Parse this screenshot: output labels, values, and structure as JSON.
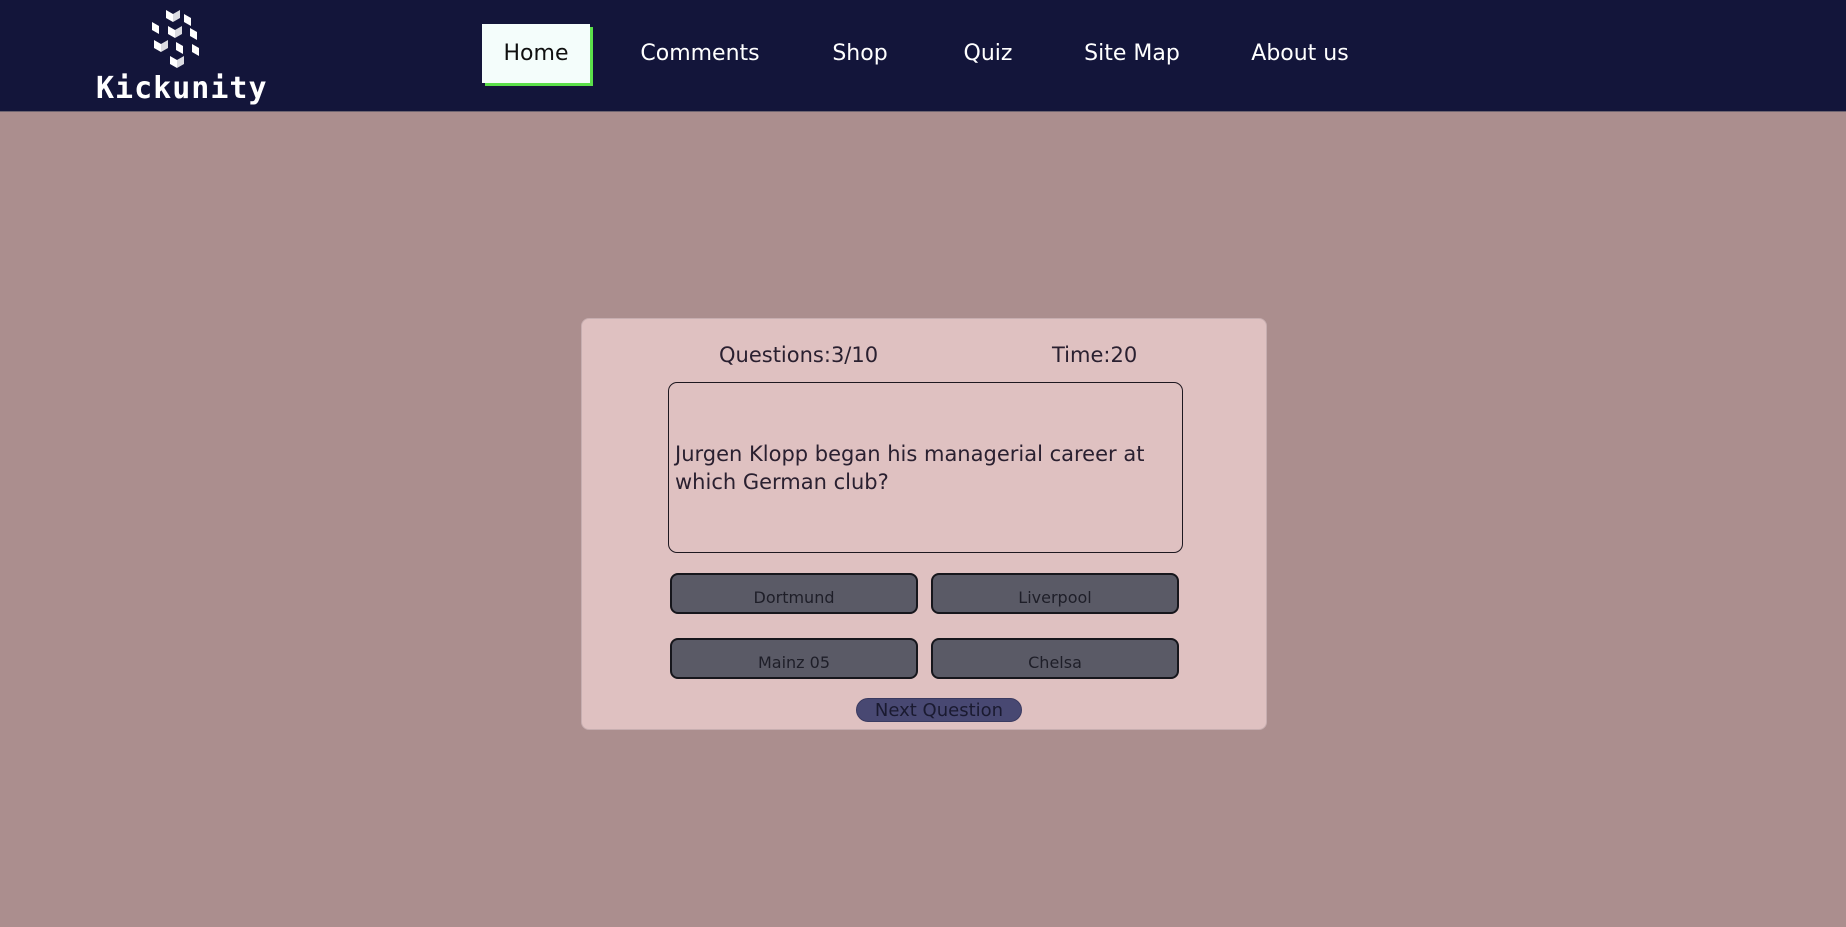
{
  "brand": {
    "name": "Kickunity",
    "logo_icon": "stacked-cubes-logo-icon"
  },
  "nav": {
    "items": [
      {
        "label": "Home",
        "active": true
      },
      {
        "label": "Comments",
        "active": false
      },
      {
        "label": "Shop",
        "active": false
      },
      {
        "label": "Quiz",
        "active": false
      },
      {
        "label": "Site Map",
        "active": false
      },
      {
        "label": "About us",
        "active": false
      }
    ]
  },
  "quiz": {
    "progress_text": "Questions:3/10",
    "timer_text": "Time:20",
    "question": "Jurgen Klopp began his managerial career at which German club?",
    "answers": [
      "Dortmund",
      "Liverpool",
      "Mainz 05",
      "Chelsa"
    ],
    "next_label": "Next Question"
  },
  "colors": {
    "navbar_bg": "#13153a",
    "page_bg": "#ab8e8e",
    "card_bg": "#dfc1c1",
    "answer_bg": "#5a5a66",
    "next_bg": "#484872",
    "active_accent": "#5be04a"
  }
}
